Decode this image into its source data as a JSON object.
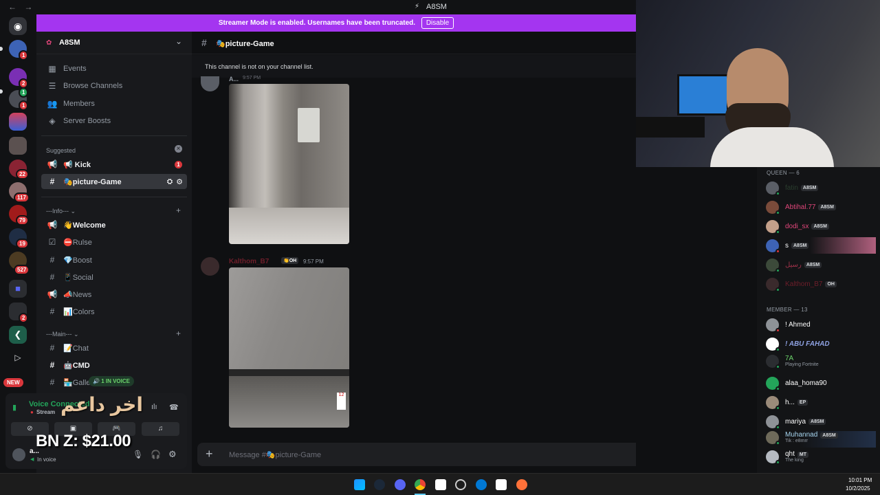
{
  "window": {
    "title": "A8SM",
    "nav": "← →"
  },
  "banner": {
    "text": "Streamer Mode is enabled. Usernames have been truncated.",
    "button": "Disable"
  },
  "servers": {
    "badges": [
      "1",
      "2",
      "1",
      "1",
      "22",
      "117",
      "79",
      "19",
      "527",
      "2"
    ],
    "new_label": "NEW"
  },
  "server": {
    "name": "A8SM",
    "chevron": "⌄"
  },
  "menu": [
    {
      "label": "Events"
    },
    {
      "label": "Browse Channels"
    },
    {
      "label": "Members"
    },
    {
      "label": "Server Boosts"
    }
  ],
  "suggested": {
    "label": "Suggested",
    "close": "×"
  },
  "channels": {
    "kick": {
      "name": "📢 Kick",
      "badge": "1"
    },
    "picture": {
      "name": "🎭picture-Game"
    },
    "info_cat": "---Info--- ⌄",
    "welcome": "👋Welcome",
    "rulse": "⛔Rulse",
    "boost": "💎Boost",
    "social": "📱Social",
    "news": "📣News",
    "colors": "📊Colors",
    "main_cat": "---Main--- ⌄",
    "chat": "📝Chat",
    "cmd": "🤖CMD",
    "gallery": "🏪Galle",
    "in_voice": "1 IN VOICE"
  },
  "voice": {
    "status": "Voice Connected",
    "stream": "Stream",
    "user": "a...",
    "user_status": "In voice"
  },
  "overlay": {
    "arabic": "اخر داعم",
    "amount": "BN Z: $21.00"
  },
  "chat": {
    "channel": "🎭picture-Game",
    "notice": "This channel is not on your channel list.",
    "msg1": {
      "author": "A...",
      "time": "9:57 PM"
    },
    "msg2": {
      "author": "Kalthom_B7",
      "tag": "👏OH",
      "time": "9:57 PM"
    },
    "composer_placeholder": "Message #🎭picture-Game"
  },
  "members": {
    "queen_header": "QUEEN — 6",
    "member_header": "MEMBER — 13",
    "queen": [
      {
        "name": "fatin",
        "tag": "A8SM",
        "color": "#2a3e2e"
      },
      {
        "name": "Abtihal.77",
        "tag": "A8SM",
        "color": "#e0467a"
      },
      {
        "name": "dodi_sx",
        "tag": "A8SM",
        "color": "#e0467a"
      },
      {
        "name": "s",
        "tag": "A8SM",
        "color": "#ffffff"
      },
      {
        "name": "رسيل",
        "tag": "A8SM",
        "color": "#a0324a"
      },
      {
        "name": "Kalthom_B7",
        "tag": "OH",
        "color": "#6e1e2a"
      }
    ],
    "member": [
      {
        "name": "! Ahmed",
        "tag": "",
        "sub": "",
        "color": "#ffffff"
      },
      {
        "name": "! ABU FAHAD",
        "tag": "",
        "sub": "",
        "color": "#8ea1e1"
      },
      {
        "name": "7A",
        "tag": "",
        "sub": "Playing Fortnite",
        "color": "#6bd36b"
      },
      {
        "name": "alaa_homa90",
        "tag": "",
        "sub": "",
        "color": "#ffffff"
      },
      {
        "name": "h...",
        "tag": "EP",
        "sub": "",
        "color": "#ffffff"
      },
      {
        "name": "mariya",
        "tag": "A8SM",
        "sub": "",
        "color": "#ffffff"
      },
      {
        "name": "Muhannad",
        "tag": "A8SM",
        "sub": "Tik : e8mrr",
        "color": "#a7d5ef"
      },
      {
        "name": "qht",
        "tag": "MT",
        "sub": "The king",
        "color": "#ffffff"
      }
    ]
  },
  "clock": {
    "time": "10:01 PM",
    "date": "10/2/2025"
  }
}
